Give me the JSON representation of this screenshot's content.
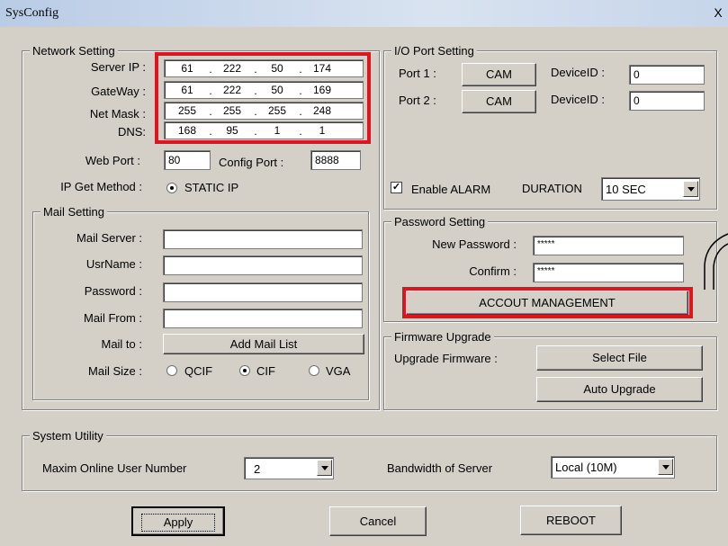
{
  "window": {
    "title": "SysConfig",
    "close_glyph": "X"
  },
  "network": {
    "legend": "Network Setting",
    "server_ip_label": "Server IP :",
    "server_ip": [
      "61",
      "222",
      "50",
      "174"
    ],
    "gateway_label": "GateWay :",
    "gateway": [
      "61",
      "222",
      "50",
      "169"
    ],
    "netmask_label": "Net Mask :",
    "netmask": [
      "255",
      "255",
      "255",
      "248"
    ],
    "dns_label": "DNS:",
    "dns": [
      "168",
      "95",
      "1",
      "1"
    ],
    "web_port_label": "Web Port :",
    "web_port": "80",
    "config_port_label": "Config Port :",
    "config_port": "8888",
    "ip_method_label": "IP Get Method :",
    "ip_method_option": "STATIC IP"
  },
  "mail": {
    "legend": "Mail Setting",
    "server_label": "Mail Server :",
    "server_value": "",
    "username_label": "UsrName :",
    "username_value": "",
    "password_label": "Password :",
    "password_value": "",
    "from_label": "Mail From :",
    "from_value": "",
    "to_label": "Mail to :",
    "add_list_button": "Add Mail List",
    "size_label": "Mail Size :",
    "size_options": [
      "QCIF",
      "CIF",
      "VGA"
    ],
    "size_selected": "CIF"
  },
  "io": {
    "legend": "I/O Port Setting",
    "port1_label": "Port 1 :",
    "port1_button": "CAM",
    "port1_device_label": "DeviceID :",
    "port1_device_value": "0",
    "port2_label": "Port 2 :",
    "port2_button": "CAM",
    "port2_device_label": "DeviceID :",
    "port2_device_value": "0",
    "alarm_checked": true,
    "alarm_label": "Enable ALARM",
    "duration_label": "DURATION",
    "duration_value": "10 SEC"
  },
  "password": {
    "legend": "Password Setting",
    "new_label": "New Password :",
    "new_value": "*****",
    "confirm_label": "Confirm :",
    "confirm_value": "*****",
    "account_button": "ACCOUT MANAGEMENT"
  },
  "firmware": {
    "legend": "Firmware Upgrade",
    "upgrade_label": "Upgrade Firmware :",
    "select_file_button": "Select File",
    "auto_upgrade_button": "Auto Upgrade"
  },
  "system": {
    "legend": "System Utility",
    "max_users_label": "Maxim Online User Number",
    "max_users_value": "2",
    "bandwidth_label": "Bandwidth of Server",
    "bandwidth_value": "Local (10M)"
  },
  "buttons": {
    "apply": "Apply",
    "cancel": "Cancel",
    "reboot": "REBOOT"
  },
  "colors": {
    "highlight_red": "#e0141e",
    "dialog_bg": "#d4d0c8"
  }
}
